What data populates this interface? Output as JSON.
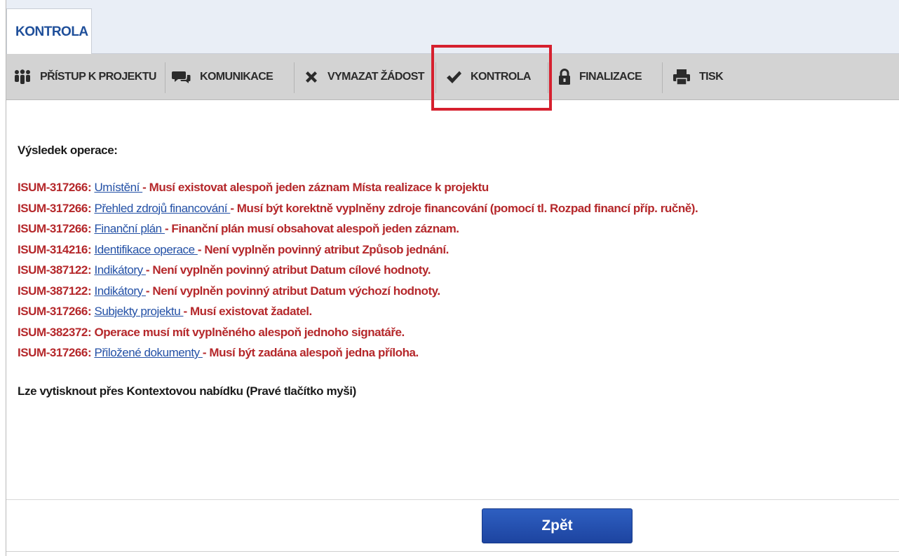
{
  "active_tab": {
    "label": "KONTROLA"
  },
  "toolbar": {
    "items": [
      {
        "label": "PŘÍSTUP K PROJEKTU",
        "icon": "users-icon"
      },
      {
        "label": "KOMUNIKACE",
        "icon": "chat-icon"
      },
      {
        "label": "VYMAZAT ŽÁDOST",
        "icon": "x-icon"
      },
      {
        "label": "KONTROLA",
        "icon": "checkmark-icon"
      },
      {
        "label": "FINALIZACE",
        "icon": "lock-icon"
      },
      {
        "label": "TISK",
        "icon": "printer-icon"
      }
    ]
  },
  "result": {
    "title": "Výsledek operace:",
    "errors": [
      {
        "code": "ISUM-317266:",
        "link": "Umístění ",
        "message": "- Musí existovat alespoň jeden záznam Místa realizace k projektu"
      },
      {
        "code": "ISUM-317266:",
        "link": "Přehled zdrojů financování ",
        "message": "- Musí být korektně vyplněny zdroje financování (pomocí tl. Rozpad financí příp. ručně)."
      },
      {
        "code": "ISUM-317266:",
        "link": "Finanční plán ",
        "message": "- Finanční plán musí obsahovat alespoň jeden záznam."
      },
      {
        "code": "ISUM-314216:",
        "link": "Identifikace operace ",
        "message": "- Není vyplněn povinný atribut Způsob jednání."
      },
      {
        "code": "ISUM-387122:",
        "link": "Indikátory ",
        "message": "- Není vyplněn povinný atribut Datum cílové hodnoty."
      },
      {
        "code": "ISUM-387122:",
        "link": "Indikátory ",
        "message": "- Není vyplněn povinný atribut Datum výchozí hodnoty."
      },
      {
        "code": "ISUM-317266:",
        "link": "Subjekty projektu ",
        "message": "- Musí existovat žadatel."
      },
      {
        "code": "ISUM-382372:",
        "link": "",
        "message": "Operace musí mít vyplněného alespoň jednoho signatáře."
      },
      {
        "code": "ISUM-317266:",
        "link": "Přiložené dokumenty ",
        "message": "- Musí být zadána alespoň jedna příloha."
      }
    ],
    "note": "Lze vytisknout přes Kontextovou nabídku (Pravé tlačítko myši)"
  },
  "buttons": {
    "back": "Zpět"
  },
  "colors": {
    "highlight": "#d6202e",
    "error_text": "#b5282b",
    "link": "#2451a6",
    "button": "#1d44a0"
  }
}
